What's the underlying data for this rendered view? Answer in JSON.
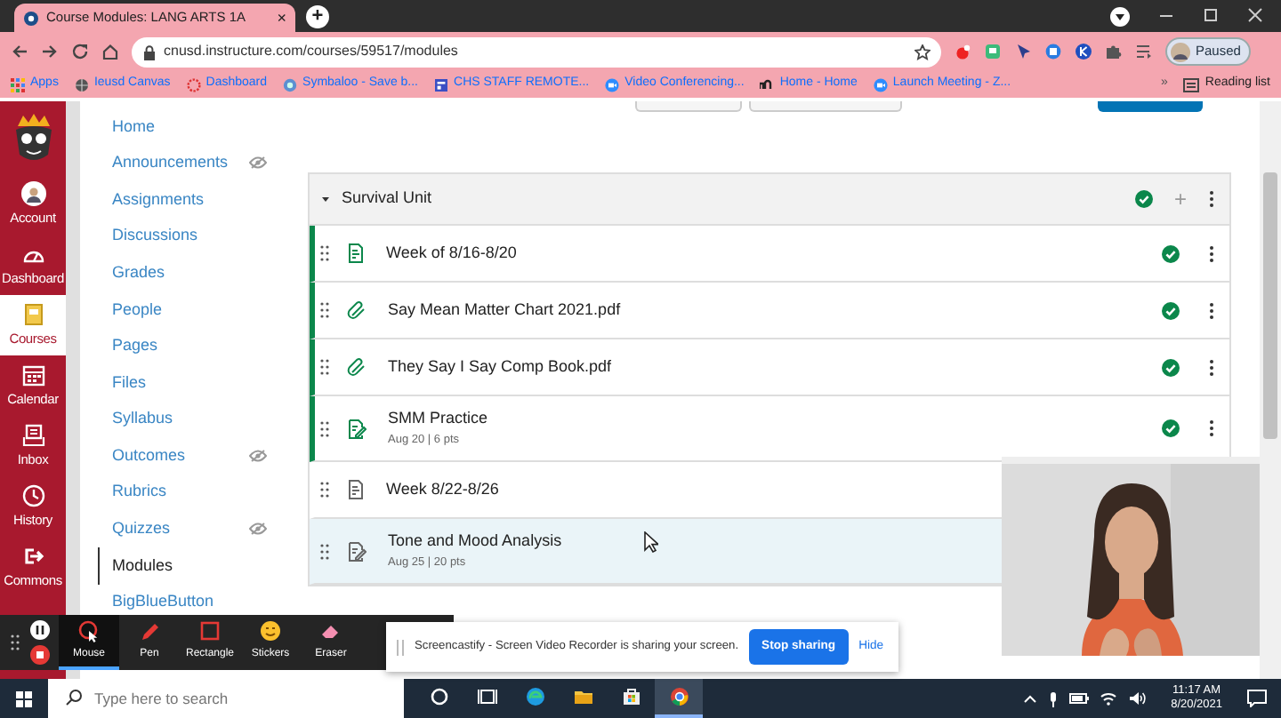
{
  "browser": {
    "tab": {
      "title": "Course Modules: LANG ARTS 1A",
      "close": "×"
    },
    "new_tab": "+",
    "url": "cnusd.instructure.com/courses/59517/modules",
    "profile": "Paused",
    "bookmarks": [
      {
        "label": "Apps",
        "kind": "apps"
      },
      {
        "label": "Ieusd Canvas",
        "kind": "globe"
      },
      {
        "label": "Dashboard",
        "kind": "ring"
      },
      {
        "label": "Symbaloo - Save b...",
        "kind": "symbaloo"
      },
      {
        "label": "CHS STAFF REMOTE...",
        "kind": "page"
      },
      {
        "label": "Video Conferencing...",
        "kind": "zoom"
      },
      {
        "label": "Home - Home",
        "kind": "home"
      },
      {
        "label": "Launch Meeting - Z...",
        "kind": "zoom"
      }
    ],
    "overflow": "»",
    "reading_list": "Reading list"
  },
  "global_nav": [
    {
      "label": "Account",
      "kind": "account",
      "selected": false
    },
    {
      "label": "Dashboard",
      "kind": "dashboard",
      "selected": false
    },
    {
      "label": "Courses",
      "kind": "courses",
      "selected": true
    },
    {
      "label": "Calendar",
      "kind": "calendar",
      "selected": false
    },
    {
      "label": "Inbox",
      "kind": "inbox",
      "selected": false
    },
    {
      "label": "History",
      "kind": "history",
      "selected": false
    },
    {
      "label": "Commons",
      "kind": "commons",
      "selected": false
    }
  ],
  "course_nav": [
    {
      "label": "Home",
      "hidden": false,
      "selected": false
    },
    {
      "label": "Announcements",
      "hidden": true,
      "selected": false
    },
    {
      "label": "Assignments",
      "hidden": false,
      "selected": false
    },
    {
      "label": "Discussions",
      "hidden": false,
      "selected": false
    },
    {
      "label": "Grades",
      "hidden": false,
      "selected": false
    },
    {
      "label": "People",
      "hidden": false,
      "selected": false
    },
    {
      "label": "Pages",
      "hidden": false,
      "selected": false
    },
    {
      "label": "Files",
      "hidden": false,
      "selected": false
    },
    {
      "label": "Syllabus",
      "hidden": false,
      "selected": false
    },
    {
      "label": "Outcomes",
      "hidden": true,
      "selected": false
    },
    {
      "label": "Rubrics",
      "hidden": false,
      "selected": false
    },
    {
      "label": "Quizzes",
      "hidden": true,
      "selected": false
    },
    {
      "label": "Modules",
      "hidden": false,
      "selected": true
    },
    {
      "label": "BigBlueButton",
      "hidden": false,
      "selected": false
    }
  ],
  "module": {
    "title": "Survival Unit",
    "expanded": true,
    "published": true,
    "add": "+",
    "items": [
      {
        "title": "Week of 8/16-8/20",
        "kind": "page",
        "published": true,
        "highlighted": false
      },
      {
        "title": "Say Mean Matter Chart 2021.pdf",
        "kind": "file",
        "published": true,
        "highlighted": false
      },
      {
        "title": "They Say I Say Comp Book.pdf",
        "kind": "file",
        "published": true,
        "highlighted": false
      },
      {
        "title": "SMM Practice",
        "kind": "assignment",
        "meta": "Aug 20 | 6 pts",
        "published": true,
        "highlighted": false
      },
      {
        "title": "Week 8/22-8/26",
        "kind": "page",
        "published": false,
        "highlighted": false
      },
      {
        "title": "Tone and Mood Analysis",
        "kind": "assignment",
        "meta": "Aug 25 | 20 pts",
        "published": false,
        "highlighted": true
      }
    ]
  },
  "recorder_toolbar": {
    "tools": [
      {
        "label": "Mouse",
        "kind": "mouse",
        "selected": true
      },
      {
        "label": "Pen",
        "kind": "pen",
        "selected": false
      },
      {
        "label": "Rectangle",
        "kind": "rectangle",
        "selected": false
      },
      {
        "label": "Stickers",
        "kind": "stickers",
        "selected": false
      },
      {
        "label": "Eraser",
        "kind": "eraser",
        "selected": false
      }
    ]
  },
  "share_banner": {
    "message": "Screencastify - Screen Video Recorder is sharing your screen.",
    "stop_button": "Stop sharing",
    "hide_link": "Hide"
  },
  "taskbar": {
    "search_placeholder": "Type here to search",
    "apps": [
      {
        "kind": "cortana",
        "active": false
      },
      {
        "kind": "taskview",
        "active": false
      },
      {
        "kind": "edge",
        "active": false
      },
      {
        "kind": "explorer",
        "active": false
      },
      {
        "kind": "store",
        "active": false
      },
      {
        "kind": "chrome",
        "active": true
      }
    ],
    "time": "11:17 AM",
    "date": "8/20/2021"
  }
}
